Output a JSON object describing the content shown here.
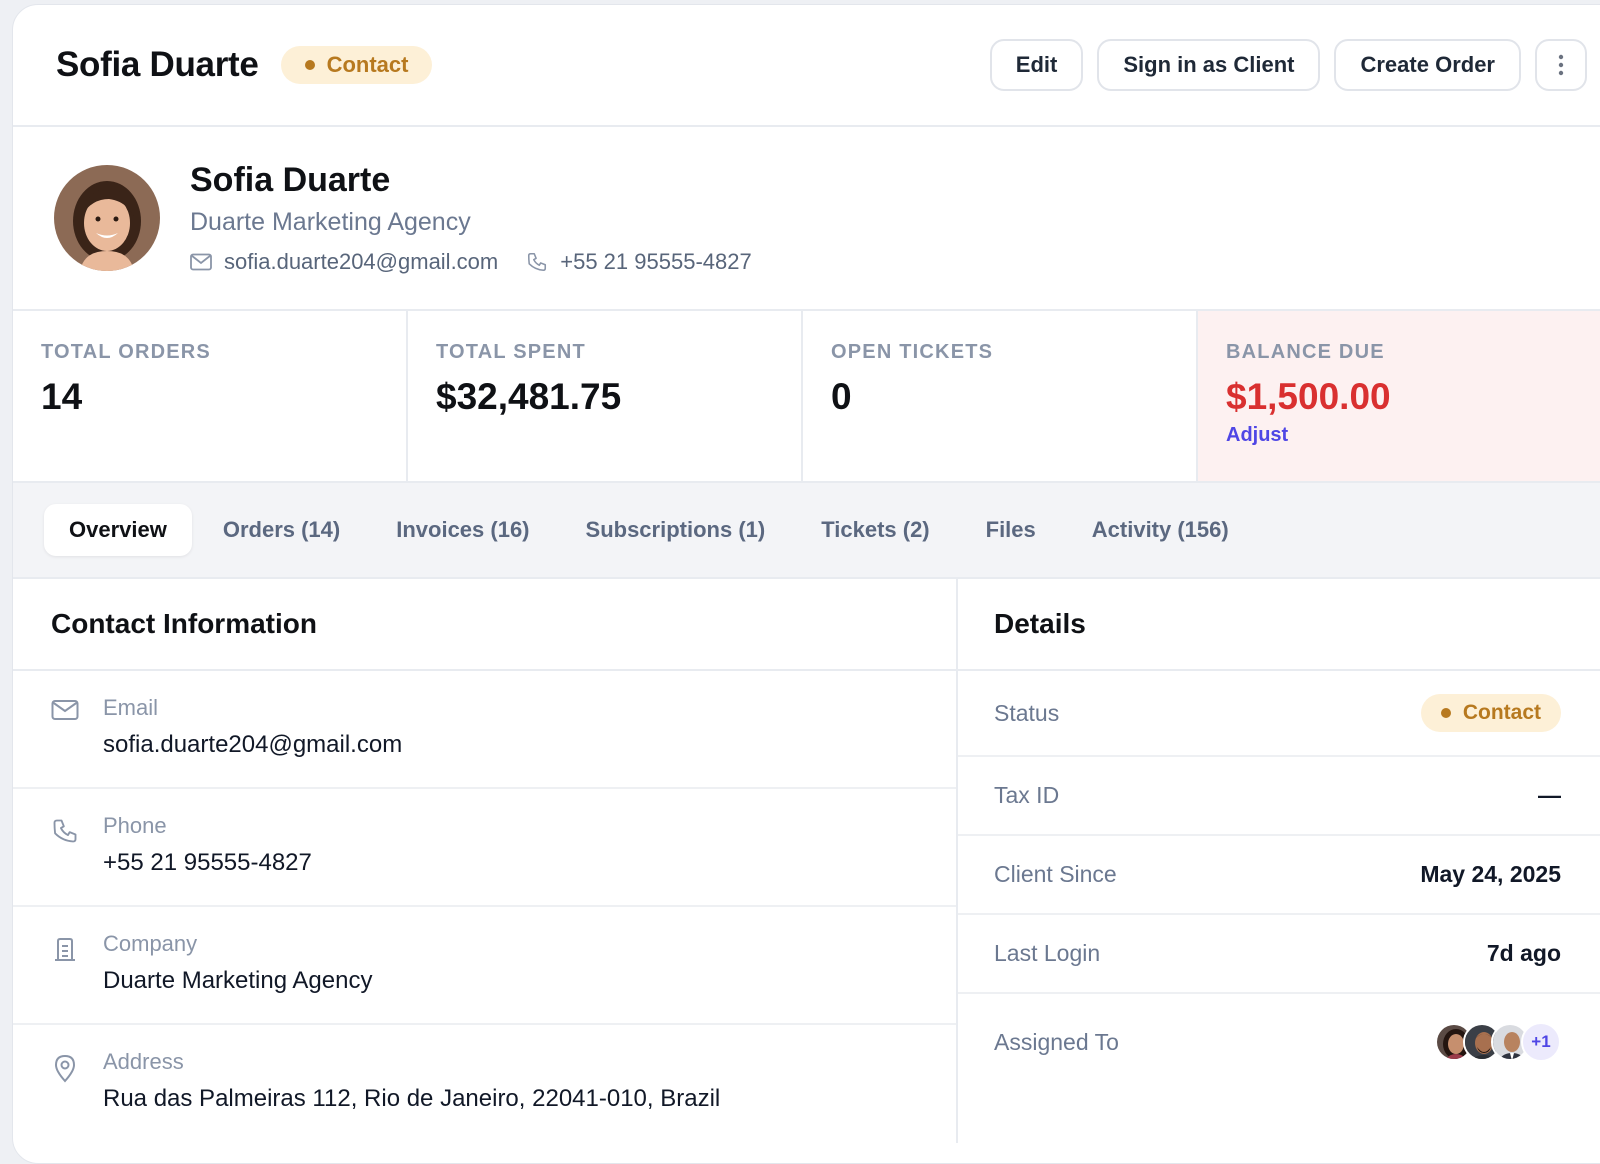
{
  "header": {
    "title": "Sofia Duarte",
    "status_badge": "Contact",
    "actions": {
      "edit": "Edit",
      "sign_in": "Sign in as Client",
      "create_order": "Create Order"
    },
    "more_icon": "vertical-dots-icon"
  },
  "profile": {
    "name": "Sofia Duarte",
    "company": "Duarte Marketing Agency",
    "email": "sofia.duarte204@gmail.com",
    "phone": "+55 21 95555-4827"
  },
  "stats": [
    {
      "label": "TOTAL ORDERS",
      "value": "14"
    },
    {
      "label": "TOTAL SPENT",
      "value": "$32,481.75"
    },
    {
      "label": "OPEN TICKETS",
      "value": "0"
    },
    {
      "label": "BALANCE DUE",
      "value": "$1,500.00",
      "link": "Adjust",
      "color": "#d93030"
    }
  ],
  "tabs": [
    {
      "label": "Overview",
      "active": true
    },
    {
      "label": "Orders (14)"
    },
    {
      "label": "Invoices (16)"
    },
    {
      "label": "Subscriptions (1)"
    },
    {
      "label": "Tickets (2)"
    },
    {
      "label": "Files"
    },
    {
      "label": "Activity (156)"
    }
  ],
  "contact_info": {
    "title": "Contact Information",
    "rows": [
      {
        "icon": "mail-icon",
        "label": "Email",
        "value": "sofia.duarte204@gmail.com"
      },
      {
        "icon": "phone-icon",
        "label": "Phone",
        "value": "+55 21 95555-4827"
      },
      {
        "icon": "building-icon",
        "label": "Company",
        "value": "Duarte Marketing Agency"
      },
      {
        "icon": "map-pin-icon",
        "label": "Address",
        "value": "Rua das Palmeiras 112, Rio de Janeiro, 22041-010, Brazil"
      }
    ]
  },
  "details": {
    "title": "Details",
    "status_label": "Status",
    "status_value": "Contact",
    "tax_id_label": "Tax ID",
    "tax_id_value": "—",
    "client_since_label": "Client Since",
    "client_since_value": "May 24, 2025",
    "last_login_label": "Last Login",
    "last_login_value": "7d ago",
    "assigned_label": "Assigned To",
    "assigned_extra": "+1"
  },
  "colors": {
    "accent": "#4f46e5",
    "badge_bg": "#fdf0d7",
    "badge_text": "#b7791f",
    "danger": "#d93030",
    "balance_bg": "#fdf1f1"
  }
}
